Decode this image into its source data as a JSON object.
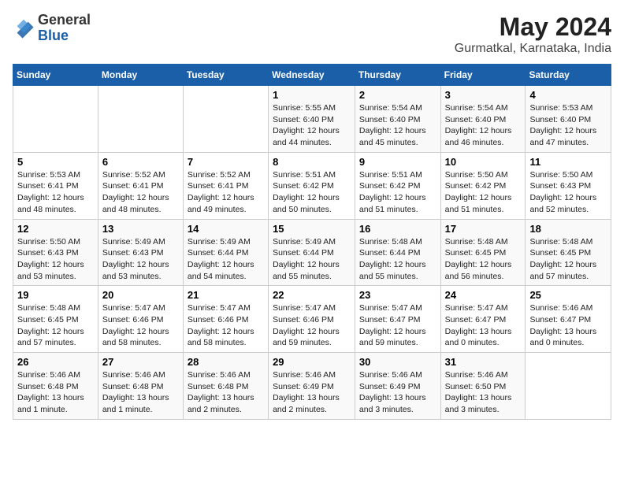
{
  "header": {
    "logo_general": "General",
    "logo_blue": "Blue",
    "month_year": "May 2024",
    "location": "Gurmatkal, Karnataka, India"
  },
  "weekdays": [
    "Sunday",
    "Monday",
    "Tuesday",
    "Wednesday",
    "Thursday",
    "Friday",
    "Saturday"
  ],
  "weeks": [
    [
      {
        "day": "",
        "info": ""
      },
      {
        "day": "",
        "info": ""
      },
      {
        "day": "",
        "info": ""
      },
      {
        "day": "1",
        "info": "Sunrise: 5:55 AM\nSunset: 6:40 PM\nDaylight: 12 hours\nand 44 minutes."
      },
      {
        "day": "2",
        "info": "Sunrise: 5:54 AM\nSunset: 6:40 PM\nDaylight: 12 hours\nand 45 minutes."
      },
      {
        "day": "3",
        "info": "Sunrise: 5:54 AM\nSunset: 6:40 PM\nDaylight: 12 hours\nand 46 minutes."
      },
      {
        "day": "4",
        "info": "Sunrise: 5:53 AM\nSunset: 6:40 PM\nDaylight: 12 hours\nand 47 minutes."
      }
    ],
    [
      {
        "day": "5",
        "info": "Sunrise: 5:53 AM\nSunset: 6:41 PM\nDaylight: 12 hours\nand 48 minutes."
      },
      {
        "day": "6",
        "info": "Sunrise: 5:52 AM\nSunset: 6:41 PM\nDaylight: 12 hours\nand 48 minutes."
      },
      {
        "day": "7",
        "info": "Sunrise: 5:52 AM\nSunset: 6:41 PM\nDaylight: 12 hours\nand 49 minutes."
      },
      {
        "day": "8",
        "info": "Sunrise: 5:51 AM\nSunset: 6:42 PM\nDaylight: 12 hours\nand 50 minutes."
      },
      {
        "day": "9",
        "info": "Sunrise: 5:51 AM\nSunset: 6:42 PM\nDaylight: 12 hours\nand 51 minutes."
      },
      {
        "day": "10",
        "info": "Sunrise: 5:50 AM\nSunset: 6:42 PM\nDaylight: 12 hours\nand 51 minutes."
      },
      {
        "day": "11",
        "info": "Sunrise: 5:50 AM\nSunset: 6:43 PM\nDaylight: 12 hours\nand 52 minutes."
      }
    ],
    [
      {
        "day": "12",
        "info": "Sunrise: 5:50 AM\nSunset: 6:43 PM\nDaylight: 12 hours\nand 53 minutes."
      },
      {
        "day": "13",
        "info": "Sunrise: 5:49 AM\nSunset: 6:43 PM\nDaylight: 12 hours\nand 53 minutes."
      },
      {
        "day": "14",
        "info": "Sunrise: 5:49 AM\nSunset: 6:44 PM\nDaylight: 12 hours\nand 54 minutes."
      },
      {
        "day": "15",
        "info": "Sunrise: 5:49 AM\nSunset: 6:44 PM\nDaylight: 12 hours\nand 55 minutes."
      },
      {
        "day": "16",
        "info": "Sunrise: 5:48 AM\nSunset: 6:44 PM\nDaylight: 12 hours\nand 55 minutes."
      },
      {
        "day": "17",
        "info": "Sunrise: 5:48 AM\nSunset: 6:45 PM\nDaylight: 12 hours\nand 56 minutes."
      },
      {
        "day": "18",
        "info": "Sunrise: 5:48 AM\nSunset: 6:45 PM\nDaylight: 12 hours\nand 57 minutes."
      }
    ],
    [
      {
        "day": "19",
        "info": "Sunrise: 5:48 AM\nSunset: 6:45 PM\nDaylight: 12 hours\nand 57 minutes."
      },
      {
        "day": "20",
        "info": "Sunrise: 5:47 AM\nSunset: 6:46 PM\nDaylight: 12 hours\nand 58 minutes."
      },
      {
        "day": "21",
        "info": "Sunrise: 5:47 AM\nSunset: 6:46 PM\nDaylight: 12 hours\nand 58 minutes."
      },
      {
        "day": "22",
        "info": "Sunrise: 5:47 AM\nSunset: 6:46 PM\nDaylight: 12 hours\nand 59 minutes."
      },
      {
        "day": "23",
        "info": "Sunrise: 5:47 AM\nSunset: 6:47 PM\nDaylight: 12 hours\nand 59 minutes."
      },
      {
        "day": "24",
        "info": "Sunrise: 5:47 AM\nSunset: 6:47 PM\nDaylight: 13 hours\nand 0 minutes."
      },
      {
        "day": "25",
        "info": "Sunrise: 5:46 AM\nSunset: 6:47 PM\nDaylight: 13 hours\nand 0 minutes."
      }
    ],
    [
      {
        "day": "26",
        "info": "Sunrise: 5:46 AM\nSunset: 6:48 PM\nDaylight: 13 hours\nand 1 minute."
      },
      {
        "day": "27",
        "info": "Sunrise: 5:46 AM\nSunset: 6:48 PM\nDaylight: 13 hours\nand 1 minute."
      },
      {
        "day": "28",
        "info": "Sunrise: 5:46 AM\nSunset: 6:48 PM\nDaylight: 13 hours\nand 2 minutes."
      },
      {
        "day": "29",
        "info": "Sunrise: 5:46 AM\nSunset: 6:49 PM\nDaylight: 13 hours\nand 2 minutes."
      },
      {
        "day": "30",
        "info": "Sunrise: 5:46 AM\nSunset: 6:49 PM\nDaylight: 13 hours\nand 3 minutes."
      },
      {
        "day": "31",
        "info": "Sunrise: 5:46 AM\nSunset: 6:50 PM\nDaylight: 13 hours\nand 3 minutes."
      },
      {
        "day": "",
        "info": ""
      }
    ]
  ]
}
